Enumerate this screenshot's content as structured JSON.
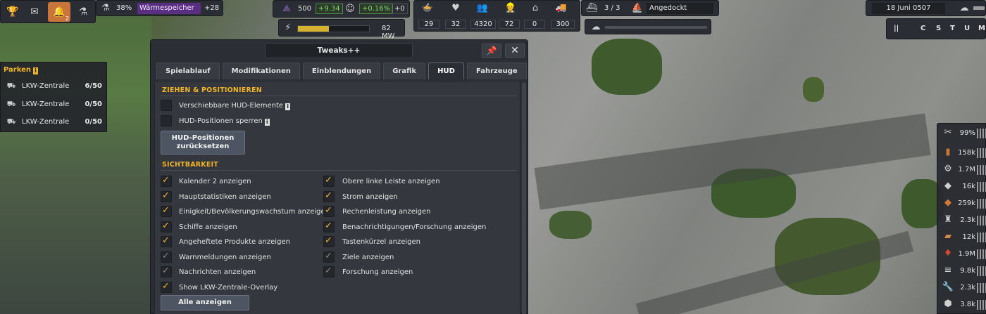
{
  "top_left_bar": {
    "percent": "38%",
    "selected_product": "Wärmespeicher",
    "delta": "+28",
    "notification_badge": "2"
  },
  "top_stats": {
    "unity": "500",
    "unity_delta": "+9.34",
    "pop_growth": "+0.16%",
    "pop_extra": "+0",
    "power": "82 MW",
    "power_fill": 0.44,
    "values": [
      "29",
      "32",
      "4320",
      "72",
      "0",
      "300"
    ]
  },
  "ships": {
    "count": "3 / 3",
    "status": "Angedockt"
  },
  "date": "18 Juni 0507",
  "speed_letters": [
    "||",
    "C",
    "S",
    "T",
    "U",
    "M"
  ],
  "parks": {
    "title": "Parken",
    "rows": [
      {
        "label": "LKW-Zentrale",
        "value": "6/50"
      },
      {
        "label": "LKW-Zentrale",
        "value": "0/50"
      },
      {
        "label": "LKW-Zentrale",
        "value": "0/50"
      }
    ]
  },
  "window": {
    "title": "Tweaks++",
    "tabs": [
      "Spielablauf",
      "Modifikationen",
      "Einblendungen",
      "Grafik",
      "HUD",
      "Fahrzeuge"
    ],
    "active_tab": "HUD",
    "section1": "ZIEHEN & POSITIONIEREN",
    "drag_options": [
      {
        "label": "Verschiebbare HUD-Elemente",
        "checked": false
      },
      {
        "label": "HUD-Positionen sperren",
        "checked": false
      }
    ],
    "reset_button": [
      "HUD-Positionen",
      "zurücksetzen"
    ],
    "section2": "SICHTBARKEIT",
    "visibility_left": [
      {
        "label": "Kalender 2 anzeigen",
        "checked": true,
        "dim": false
      },
      {
        "label": "Hauptstatistiken anzeigen",
        "checked": true,
        "dim": false
      },
      {
        "label": "Einigkeit/Bevölkerungswachstum anzeigen",
        "checked": true,
        "dim": false
      },
      {
        "label": "Schiffe anzeigen",
        "checked": true,
        "dim": false
      },
      {
        "label": "Angeheftete Produkte anzeigen",
        "checked": true,
        "dim": false
      },
      {
        "label": "Warnmeldungen anzeigen",
        "checked": true,
        "dim": true
      },
      {
        "label": "Nachrichten anzeigen",
        "checked": true,
        "dim": true
      },
      {
        "label": "Show LKW-Zentrale-Overlay",
        "checked": true,
        "dim": false
      }
    ],
    "visibility_right": [
      {
        "label": "Obere linke Leiste anzeigen",
        "checked": true,
        "dim": false
      },
      {
        "label": "Strom anzeigen",
        "checked": true,
        "dim": false
      },
      {
        "label": "Rechenleistung anzeigen",
        "checked": true,
        "dim": false
      },
      {
        "label": "Benachrichtigungen/Forschung anzeigen",
        "checked": true,
        "dim": false
      },
      {
        "label": "Tastenkürzel anzeigen",
        "checked": true,
        "dim": false
      },
      {
        "label": "Ziele anzeigen",
        "checked": true,
        "dim": true
      },
      {
        "label": "Forschung anzeigen",
        "checked": true,
        "dim": true
      }
    ],
    "show_all_button": "Alle anzeigen"
  },
  "right_products": [
    "99%",
    "158k",
    "1.7M",
    "16k",
    "259k",
    "2.3k",
    "12k",
    "1.9M",
    "9.8k",
    "2.3k",
    "3.8k"
  ],
  "colors": {
    "accent": "#f0b429",
    "green": "#7cdc6b",
    "purple": "#8a54d6"
  }
}
